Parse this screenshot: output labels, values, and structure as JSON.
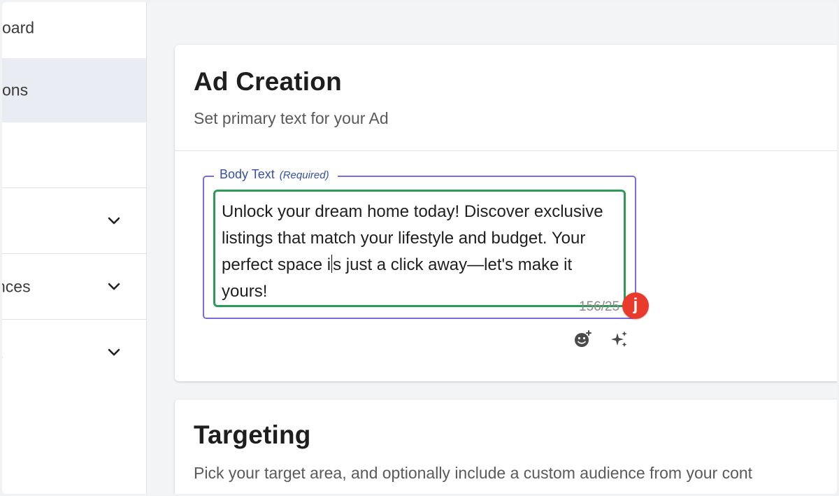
{
  "sidebar": {
    "items": [
      {
        "label": "oard"
      },
      {
        "label": "ons"
      },
      {
        "label": ""
      },
      {
        "label": ""
      },
      {
        "label": "nces"
      },
      {
        "label": "t"
      }
    ],
    "chevron_icon": "chevron-down-icon"
  },
  "ad_creation": {
    "title": "Ad Creation",
    "subtitle": "Set primary text for your Ad",
    "body_field": {
      "label": "Body Text",
      "required_label": "(Required)",
      "value_before_cursor": "Unlock your dream home today! Discover exclusive listings that match your lifestyle and budget. Your perfect space i",
      "value_after_cursor": "s just a click away—let's make it yours!",
      "counter": "156/25",
      "badge": "j"
    },
    "tools": {
      "emoji_icon": "add-emoji-icon",
      "ai_icon": "sparkle-ai-icon"
    }
  },
  "targeting": {
    "title": "Targeting",
    "subtitle": "Pick your target area, and optionally include a custom audience from your cont"
  },
  "colors": {
    "field_border": "#7b6ad9",
    "textarea_focus": "#2e9a5a",
    "badge": "#ea3a2b",
    "label": "#3450a8"
  }
}
